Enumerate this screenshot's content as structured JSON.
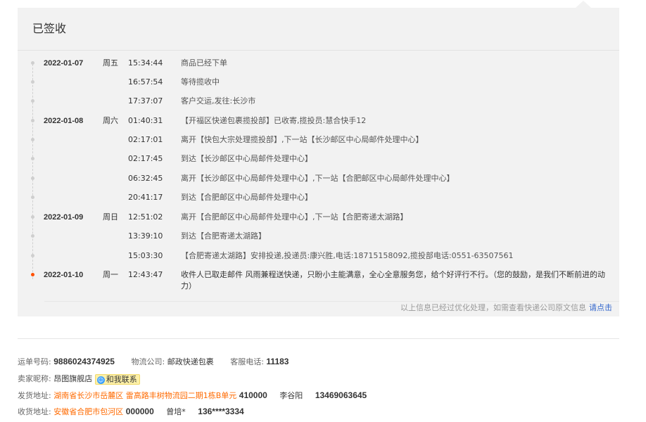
{
  "status_title": "已签收",
  "tracking": [
    {
      "date": "2022-01-07",
      "weekday": "周五",
      "time": "15:34:44",
      "desc": "商品已经下单"
    },
    {
      "date": "",
      "weekday": "",
      "time": "16:57:54",
      "desc": "等待揽收中"
    },
    {
      "date": "",
      "weekday": "",
      "time": "17:37:07",
      "desc": "客户交运,发往:长沙市"
    },
    {
      "date": "2022-01-08",
      "weekday": "周六",
      "time": "01:40:31",
      "desc": "【开福区快递包裹揽投部】已收寄,揽投员:慧合快手12"
    },
    {
      "date": "",
      "weekday": "",
      "time": "02:17:01",
      "desc": "离开【快包大宗处理揽投部】,下一站【长沙邮区中心局邮件处理中心】"
    },
    {
      "date": "",
      "weekday": "",
      "time": "02:17:45",
      "desc": "到达【长沙邮区中心局邮件处理中心】"
    },
    {
      "date": "",
      "weekday": "",
      "time": "06:32:45",
      "desc": "离开【长沙邮区中心局邮件处理中心】,下一站【合肥邮区中心局邮件处理中心】"
    },
    {
      "date": "",
      "weekday": "",
      "time": "20:41:17",
      "desc": "到达【合肥邮区中心局邮件处理中心】"
    },
    {
      "date": "2022-01-09",
      "weekday": "周日",
      "time": "12:51:02",
      "desc": "离开【合肥邮区中心局邮件处理中心】,下一站【合肥寄递太湖路】"
    },
    {
      "date": "",
      "weekday": "",
      "time": "13:39:10",
      "desc": "到达【合肥寄递太湖路】"
    },
    {
      "date": "",
      "weekday": "",
      "time": "15:03:30",
      "desc": "【合肥寄递太湖路】安排投递,投递员:康兴胜,电话:18715158092,揽投部电话:0551-63507561"
    },
    {
      "date": "2022-01-10",
      "weekday": "周一",
      "time": "12:43:47",
      "desc": "收件人已取走邮件 风雨兼程送快递，只盼小主能满意，全心全意服务您，给个好评行不行。（您的鼓励，是我们不断前进的动力）"
    }
  ],
  "note": {
    "text": "以上信息已经过优化处理，如需查看快递公司原文信息",
    "link": "请点击"
  },
  "info": {
    "waybill_label": "运单号码:",
    "waybill": "9886024374925",
    "carrier_label": "物流公司:",
    "carrier": "邮政快递包裹",
    "service_label": "客服电话:",
    "service_phone": "11183",
    "seller_label": "卖家昵称:",
    "seller": "昂图旗舰店",
    "contact_label": "和我联系",
    "ship_label": "发货地址:",
    "ship_addr": "湖南省长沙市岳麓区 雷高路丰树物流园二期1栋B单元",
    "ship_zip": "410000",
    "ship_name": "李谷阳",
    "ship_phone": "13469063645",
    "recv_label": "收货地址:",
    "recv_addr": "安徽省合肥市包河区",
    "recv_zip": "000000",
    "recv_name": "曾培*",
    "recv_phone": "136****3334"
  },
  "colors": {
    "panel_bg": "#f2f2f2",
    "active_dot": "#ff5000",
    "link": "#3366cc",
    "address": "#ff6a00",
    "contact_bg": "#fdf0a8"
  }
}
